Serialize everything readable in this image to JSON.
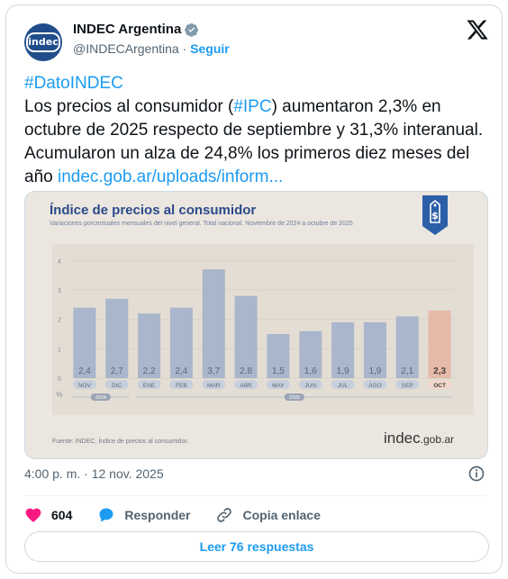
{
  "author": {
    "name": "INDEC Argentina",
    "handle": "@INDECArgentina",
    "separator": "·",
    "follow_label": "Seguir",
    "avatar_text": "indec"
  },
  "tweet": {
    "hashtag": "#DatoINDEC",
    "text_part1": "Los precios al consumidor (",
    "ipc_tag": "#IPC",
    "text_part2": ") aumentaron 2,3% en octubre de 2025 respecto de septiembre y 31,3% interanual. Acumularon un alza de 24,8% los primeros diez meses del año ",
    "link": "indec.gob.ar/uploads/inform..."
  },
  "media": {
    "logo_main": "indec",
    "logo_suffix": ".gob.ar"
  },
  "chart_data": {
    "type": "bar",
    "title": "Índice de precios al consumidor",
    "subtitle": "Variaciones porcentuales mensuales del nivel general. Total nacional. Noviembre de 2024 a octubre de 2025",
    "categories": [
      "NOV",
      "DIC",
      "ENE",
      "FEB",
      "MAR",
      "ABR",
      "MAY",
      "JUN",
      "JUL",
      "AGO",
      "SEP",
      "OCT"
    ],
    "values": [
      2.4,
      2.7,
      2.2,
      2.4,
      3.7,
      2.8,
      1.5,
      1.6,
      1.9,
      1.9,
      2.1,
      2.3
    ],
    "value_labels": [
      "2,4",
      "2,7",
      "2,2",
      "2,4",
      "3,7",
      "2,8",
      "1,5",
      "1,6",
      "1,9",
      "1,9",
      "2,1",
      "2,3"
    ],
    "highlight_index": 11,
    "ylim": [
      0,
      4
    ],
    "yticks": [
      0,
      1,
      2,
      3,
      4
    ],
    "y_unit": "%",
    "year_groups": [
      {
        "label": "2024",
        "start": 0,
        "end": 1
      },
      {
        "label": "2025",
        "start": 2,
        "end": 11
      }
    ],
    "source": "Fuente: INDEC, Índice de precios al consumidor.",
    "colors": {
      "bar": "#a9b6cb",
      "highlight": "#e6b9a8",
      "grid": "#d9d2c8"
    }
  },
  "meta": {
    "timestamp": "4:00 p. m. · 12 nov. 2025"
  },
  "actions": {
    "likes": "604",
    "reply_label": "Responder",
    "copy_label": "Copia enlace",
    "read_replies": "Leer 76 respuestas"
  },
  "colors": {
    "accent": "#1d9bf0",
    "like": "#f91880",
    "brand": "#1f4d8c"
  }
}
